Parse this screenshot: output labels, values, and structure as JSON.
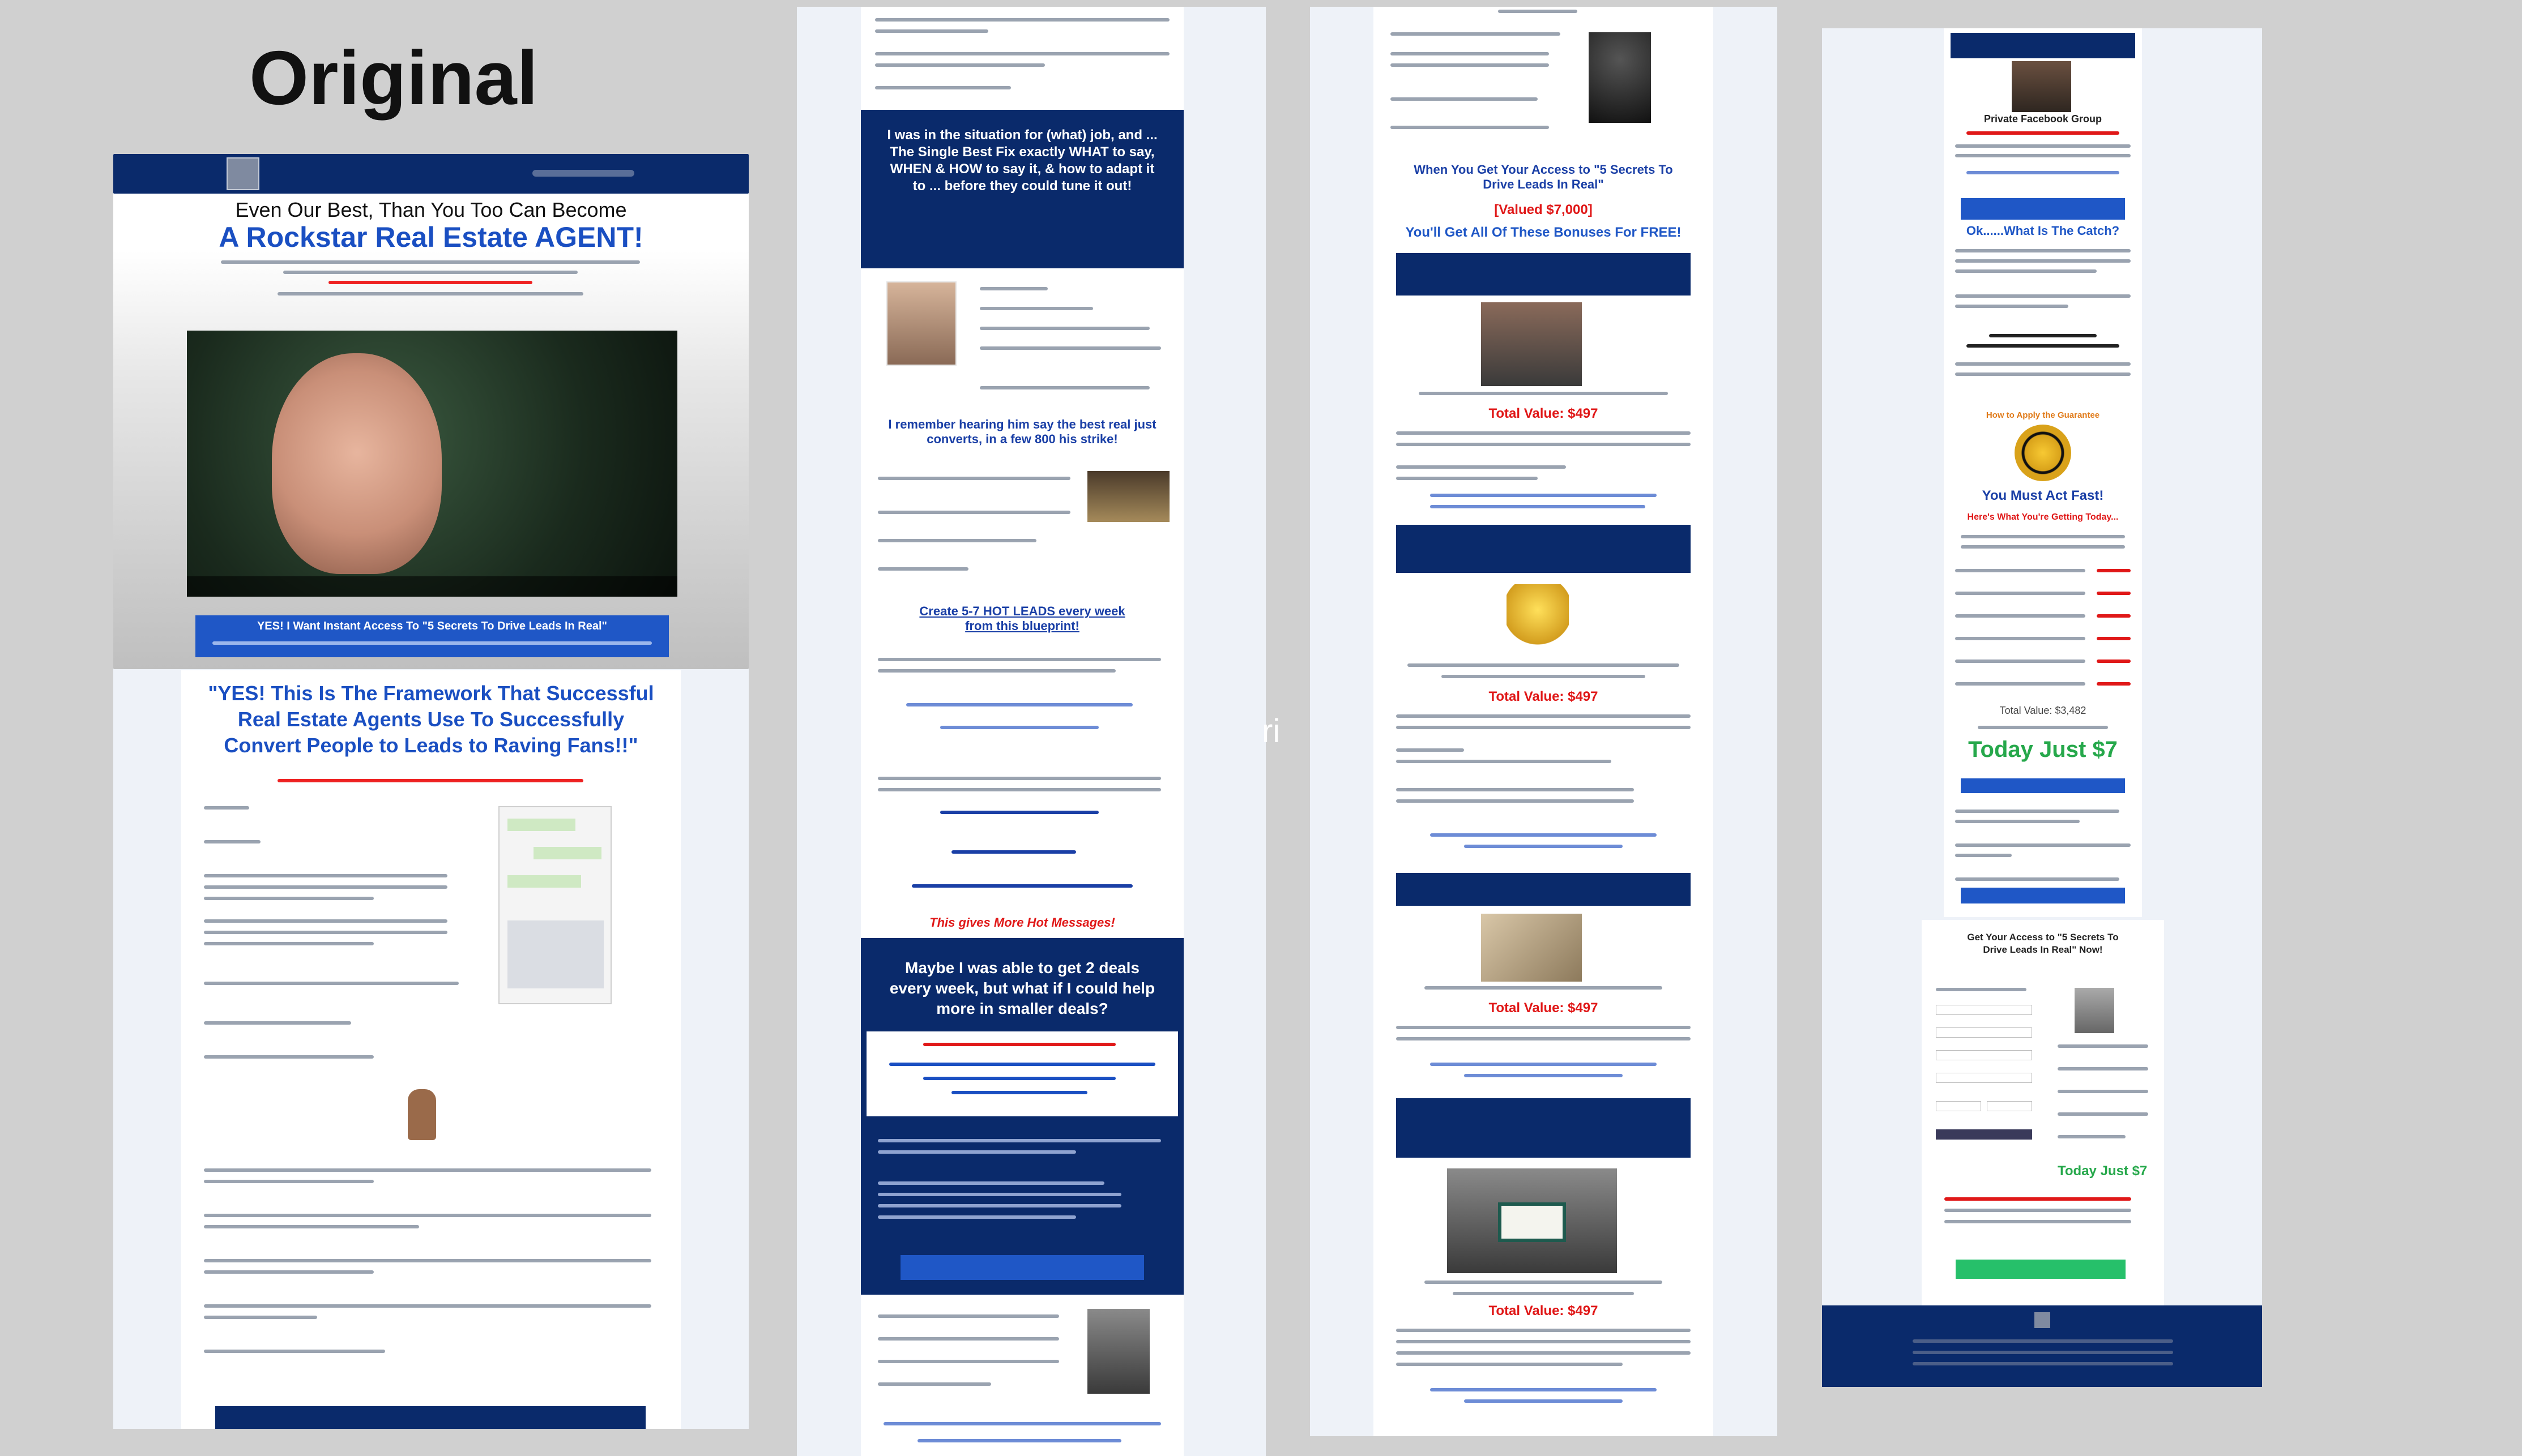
{
  "page": {
    "label": "Original"
  },
  "colors": {
    "navy": "#0a2a6b",
    "blue": "#1f57c6",
    "red": "#e01818",
    "green": "#26a84b",
    "panel": "#eef2f8"
  },
  "col1": {
    "headline_top": "Even Our Best, Than You Too Can Become",
    "headline_main": "A Rockstar Real Estate AGENT!",
    "cta_bar": "YES! I Want Instant Access To \"5 Secrets To Drive Leads In Real\"",
    "quote": "\"YES! This Is The Framework That Successful Real Estate Agents Use To Successfully Convert People to Leads to Raving Fans!!\""
  },
  "col2": {
    "band1": "I was in the situation for (what) job, and ... The Single Best Fix exactly WHAT to say, WHEN & HOW to say it, & how to adapt it to ... before they could tune it out!",
    "subhead1": "I remember hearing him say the best real just converts, in a few 800 his strike!",
    "subhead2": "Create 5-7 HOT LEADS every week from this blueprint!",
    "red_line": "This gives More Hot Messages!",
    "band2": "Maybe I was able to get 2 deals every week, but what if I could help more in smaller deals?"
  },
  "col3": {
    "header": "When You Get Your Access to \"5 Secrets To Drive Leads In Real\"",
    "header_red": "[Valued $7,000]",
    "header_blue": "You'll Get All Of These Bonuses For FREE!",
    "value_label": "Total Value: $497"
  },
  "col4": {
    "bonus_title": "Private Facebook Group",
    "catch": "Ok......What Is The Catch?",
    "guarantee": "How to Apply the Guarantee",
    "must_act": "You Must Act Fast!",
    "getting": "Here's What You're Getting Today...",
    "total_value": "Total Value: $3,482",
    "today": "Today Just $7",
    "form_title": "Get Your Access to \"5 Secrets To Drive Leads In Real\" Now!",
    "form_today": "Today Just $7"
  },
  "overlay": {
    "stray": "ri"
  }
}
